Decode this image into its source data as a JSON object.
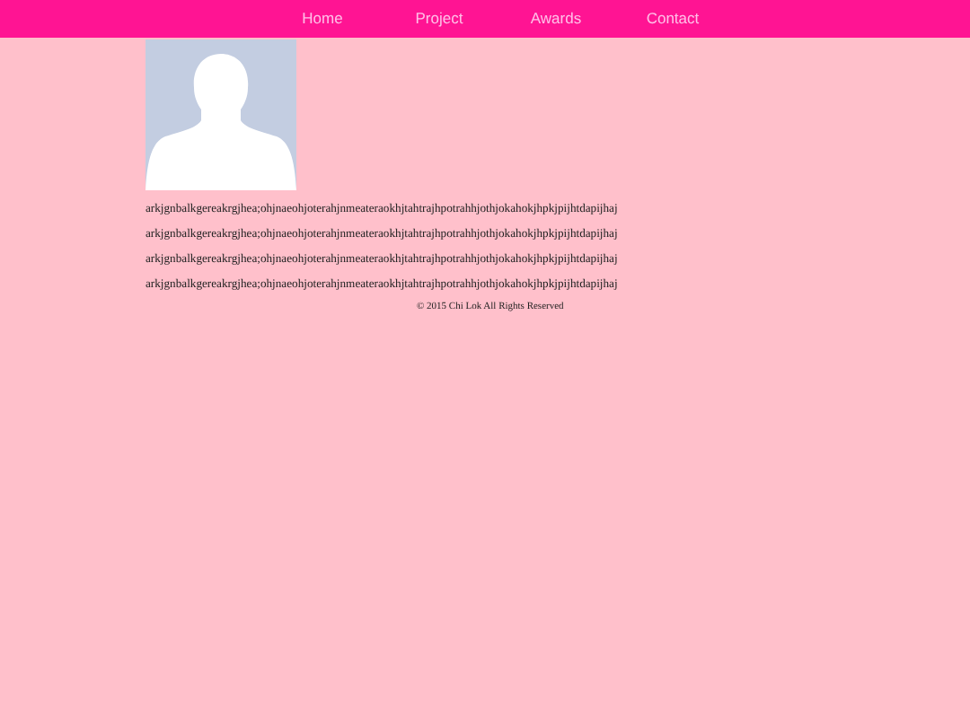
{
  "nav": [
    "Home",
    "Project",
    "Awards",
    "Contact"
  ],
  "paragraphs": [
    "arkjgnbalkgereakrgjhea;ohjnaeohjoterahjnmeateraokhjtahtrajhpotrahhjothjokahokjhpkjpijhtdapijhaj",
    "arkjgnbalkgereakrgjhea;ohjnaeohjoterahjnmeateraokhjtahtrajhpotrahhjothjokahokjhpkjpijhtdapijhaj",
    "arkjgnbalkgereakrgjhea;ohjnaeohjoterahjnmeateraokhjtahtrajhpotrahhjothjokahokjhpkjpijhtdapijhaj",
    "arkjgnbalkgereakrgjhea;ohjnaeohjoterahjnmeateraokhjtahtrajhpotrahhjothjokahokjhpkjpijhtdapijhaj"
  ],
  "footer": "© 2015 Chi Lok All Rights Reserved"
}
